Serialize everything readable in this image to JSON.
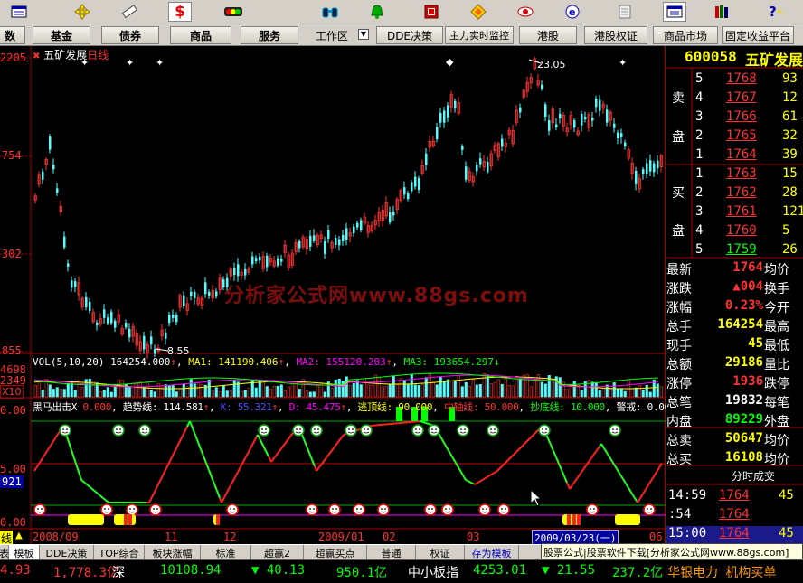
{
  "toolbar": {
    "icons": [
      "window-icon",
      "move-icon",
      "ruler-icon",
      "dollar-icon",
      "traffic-light-icon",
      "binoculars-icon",
      "bell-icon",
      "flag-icon",
      "diamond-icon",
      "eye-icon",
      "globe-icon",
      "notepad-icon",
      "window-small-icon",
      "books-icon",
      "help-icon"
    ]
  },
  "menu": {
    "b0": "数",
    "b1": "基金",
    "b2": "债券",
    "b3": "商品",
    "b4": "服务",
    "workspace": "工作区",
    "b5": "DDE决策",
    "b6": "主力实时监控",
    "b7": "港股",
    "b8": "港股权证",
    "b9": "商品市场",
    "b10": "固定收益平台"
  },
  "chart": {
    "stock_name": "五矿发展",
    "period": "日线",
    "y_labels": [
      "2205",
      "754",
      "302",
      "855"
    ],
    "high_label": "23.05",
    "low_label": "8.55",
    "watermark": "分析家公式网www.88gs.com",
    "vol_line": {
      "title": "VOL(5,10,20)",
      "v": "164254.000",
      "ma1": "MA1: 141190.406",
      "ma2": "MA2: 155120.203",
      "ma3": "MA3: 193654.297"
    },
    "vol_labels": [
      "4698",
      "2349",
      "X10"
    ],
    "ind_line": {
      "title": "黑马出击X",
      "x0": "0.000",
      "trend": "趋势线: 114.581",
      "k": "K: 55.321",
      "d": "D: 45.475",
      "escape": "逃顶线: 90.000",
      "mid": "中轴线: 50.000",
      "bottom": "抄底线: 10.000",
      "warn": "警戒: 0.000"
    },
    "ind_labels": [
      "0.00",
      "5.00",
      "921",
      "0.00"
    ],
    "dates": [
      "2008/09",
      "11",
      "12",
      "2009/01",
      "02",
      "03",
      "2009/03/23(一)",
      "06"
    ],
    "left_tab": "线"
  },
  "quote": {
    "code": "600058",
    "name": "五矿发展",
    "sell_label": [
      "卖",
      "盘"
    ],
    "buy_label": [
      "买",
      "盘"
    ],
    "asks": [
      {
        "n": "5",
        "p": "1768",
        "v": "93"
      },
      {
        "n": "4",
        "p": "1767",
        "v": "12"
      },
      {
        "n": "3",
        "p": "1766",
        "v": "61"
      },
      {
        "n": "2",
        "p": "1765",
        "v": "32"
      },
      {
        "n": "1",
        "p": "1764",
        "v": "39"
      }
    ],
    "bids": [
      {
        "n": "1",
        "p": "1763",
        "v": "15"
      },
      {
        "n": "2",
        "p": "1762",
        "v": "28"
      },
      {
        "n": "3",
        "p": "1761",
        "v": "121"
      },
      {
        "n": "4",
        "p": "1760",
        "v": "5"
      },
      {
        "n": "5",
        "p": "1759",
        "v": "26"
      }
    ],
    "stats": [
      {
        "l": "最新",
        "v": "1764",
        "r": "均价"
      },
      {
        "l": "涨跌",
        "v": "▲004",
        "r": "换手"
      },
      {
        "l": "涨幅",
        "v": "0.23%",
        "r": "今开"
      },
      {
        "l": "总手",
        "v": "164254",
        "r": "最高"
      },
      {
        "l": "现手",
        "v": "45",
        "r": "最低"
      },
      {
        "l": "总额",
        "v": "29186",
        "r": "量比"
      },
      {
        "l": "涨停",
        "v": "1936",
        "r": "跌停"
      },
      {
        "l": "总笔",
        "v": "19832",
        "r": "每笔"
      },
      {
        "l": "内盘",
        "v": "89229",
        "r": "外盘"
      },
      {
        "l": "总卖",
        "v": "50647",
        "r": "均价"
      },
      {
        "l": "总买",
        "v": "16108",
        "r": "均价"
      }
    ],
    "trade_title": "分时成交",
    "trades": [
      {
        "t": "14:59",
        "p": "1764",
        "v": "45"
      },
      {
        "t": ":54",
        "p": "1764",
        "v": ""
      },
      {
        "t": "15:00",
        "p": "1764",
        "v": "45"
      }
    ]
  },
  "tabs": [
    "表",
    "模板",
    "DDE决策",
    "TOP综合",
    "板块涨幅",
    "标准",
    "超赢2",
    "超赢买点",
    "普通",
    "权证",
    "存为模板"
  ],
  "ad": "股票公式|股票软件下载[分析家公式网www.88gs.com]",
  "status": {
    "s0": "4.93",
    "s1": "1,778.3亿",
    "s2": "深",
    "s3": "10108.94",
    "s4": "▼ 40.13",
    "s5": "950.1亿",
    "s6": "中小板指",
    "s7": "4253.01",
    "s8": "▼ 21.55",
    "s9": "237.2亿",
    "news": "华银电力 机构买单"
  },
  "colors": {
    "up": "#ff3232",
    "down": "#54fcfc",
    "green": "#00ff00",
    "yellow": "#ffff00",
    "magenta": "#ff00ff",
    "orange": "#ff9900"
  }
}
